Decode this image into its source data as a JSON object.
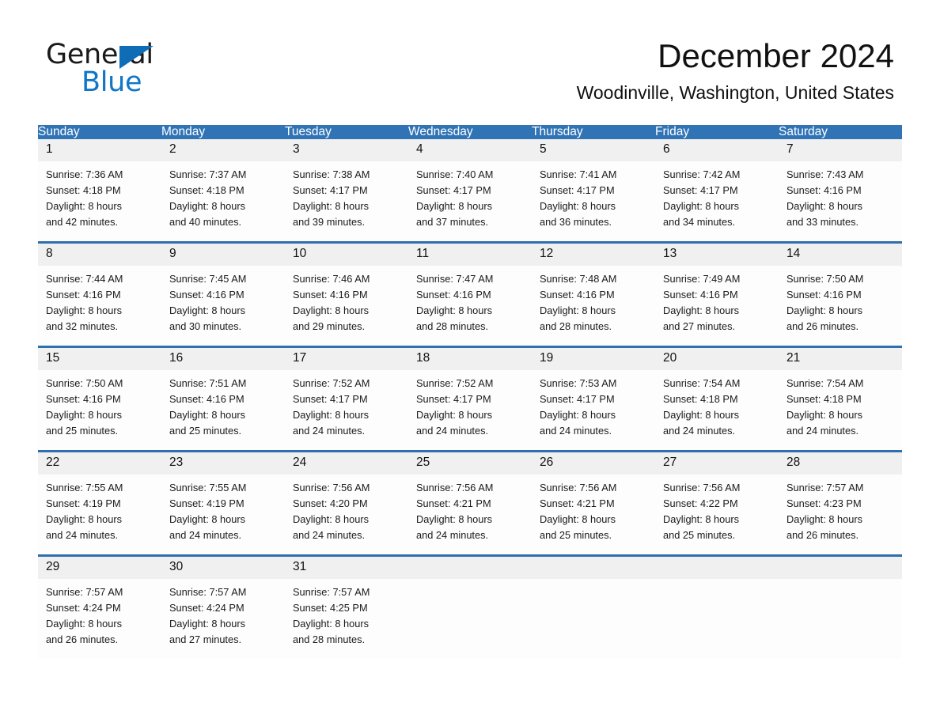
{
  "logo": {
    "word1": "General",
    "word2": "Blue",
    "triangle_color": "#0f6cb6",
    "blue_text_color": "#0f76c8"
  },
  "header": {
    "month_year": "December 2024",
    "location": "Woodinville, Washington, United States"
  },
  "theme": {
    "header_blue": "#3174b6",
    "separator_blue": "#2f6fae",
    "daynum_band": "#f0f0f0",
    "cell_background": "#fdfdfd"
  },
  "weekday_headers": [
    "Sunday",
    "Monday",
    "Tuesday",
    "Wednesday",
    "Thursday",
    "Friday",
    "Saturday"
  ],
  "weeks": [
    {
      "days": [
        {
          "num": "1",
          "sunrise": "Sunrise: 7:36 AM",
          "sunset": "Sunset: 4:18 PM",
          "daylight1": "Daylight: 8 hours",
          "daylight2": "and 42 minutes."
        },
        {
          "num": "2",
          "sunrise": "Sunrise: 7:37 AM",
          "sunset": "Sunset: 4:18 PM",
          "daylight1": "Daylight: 8 hours",
          "daylight2": "and 40 minutes."
        },
        {
          "num": "3",
          "sunrise": "Sunrise: 7:38 AM",
          "sunset": "Sunset: 4:17 PM",
          "daylight1": "Daylight: 8 hours",
          "daylight2": "and 39 minutes."
        },
        {
          "num": "4",
          "sunrise": "Sunrise: 7:40 AM",
          "sunset": "Sunset: 4:17 PM",
          "daylight1": "Daylight: 8 hours",
          "daylight2": "and 37 minutes."
        },
        {
          "num": "5",
          "sunrise": "Sunrise: 7:41 AM",
          "sunset": "Sunset: 4:17 PM",
          "daylight1": "Daylight: 8 hours",
          "daylight2": "and 36 minutes."
        },
        {
          "num": "6",
          "sunrise": "Sunrise: 7:42 AM",
          "sunset": "Sunset: 4:17 PM",
          "daylight1": "Daylight: 8 hours",
          "daylight2": "and 34 minutes."
        },
        {
          "num": "7",
          "sunrise": "Sunrise: 7:43 AM",
          "sunset": "Sunset: 4:16 PM",
          "daylight1": "Daylight: 8 hours",
          "daylight2": "and 33 minutes."
        }
      ]
    },
    {
      "days": [
        {
          "num": "8",
          "sunrise": "Sunrise: 7:44 AM",
          "sunset": "Sunset: 4:16 PM",
          "daylight1": "Daylight: 8 hours",
          "daylight2": "and 32 minutes."
        },
        {
          "num": "9",
          "sunrise": "Sunrise: 7:45 AM",
          "sunset": "Sunset: 4:16 PM",
          "daylight1": "Daylight: 8 hours",
          "daylight2": "and 30 minutes."
        },
        {
          "num": "10",
          "sunrise": "Sunrise: 7:46 AM",
          "sunset": "Sunset: 4:16 PM",
          "daylight1": "Daylight: 8 hours",
          "daylight2": "and 29 minutes."
        },
        {
          "num": "11",
          "sunrise": "Sunrise: 7:47 AM",
          "sunset": "Sunset: 4:16 PM",
          "daylight1": "Daylight: 8 hours",
          "daylight2": "and 28 minutes."
        },
        {
          "num": "12",
          "sunrise": "Sunrise: 7:48 AM",
          "sunset": "Sunset: 4:16 PM",
          "daylight1": "Daylight: 8 hours",
          "daylight2": "and 28 minutes."
        },
        {
          "num": "13",
          "sunrise": "Sunrise: 7:49 AM",
          "sunset": "Sunset: 4:16 PM",
          "daylight1": "Daylight: 8 hours",
          "daylight2": "and 27 minutes."
        },
        {
          "num": "14",
          "sunrise": "Sunrise: 7:50 AM",
          "sunset": "Sunset: 4:16 PM",
          "daylight1": "Daylight: 8 hours",
          "daylight2": "and 26 minutes."
        }
      ]
    },
    {
      "days": [
        {
          "num": "15",
          "sunrise": "Sunrise: 7:50 AM",
          "sunset": "Sunset: 4:16 PM",
          "daylight1": "Daylight: 8 hours",
          "daylight2": "and 25 minutes."
        },
        {
          "num": "16",
          "sunrise": "Sunrise: 7:51 AM",
          "sunset": "Sunset: 4:16 PM",
          "daylight1": "Daylight: 8 hours",
          "daylight2": "and 25 minutes."
        },
        {
          "num": "17",
          "sunrise": "Sunrise: 7:52 AM",
          "sunset": "Sunset: 4:17 PM",
          "daylight1": "Daylight: 8 hours",
          "daylight2": "and 24 minutes."
        },
        {
          "num": "18",
          "sunrise": "Sunrise: 7:52 AM",
          "sunset": "Sunset: 4:17 PM",
          "daylight1": "Daylight: 8 hours",
          "daylight2": "and 24 minutes."
        },
        {
          "num": "19",
          "sunrise": "Sunrise: 7:53 AM",
          "sunset": "Sunset: 4:17 PM",
          "daylight1": "Daylight: 8 hours",
          "daylight2": "and 24 minutes."
        },
        {
          "num": "20",
          "sunrise": "Sunrise: 7:54 AM",
          "sunset": "Sunset: 4:18 PM",
          "daylight1": "Daylight: 8 hours",
          "daylight2": "and 24 minutes."
        },
        {
          "num": "21",
          "sunrise": "Sunrise: 7:54 AM",
          "sunset": "Sunset: 4:18 PM",
          "daylight1": "Daylight: 8 hours",
          "daylight2": "and 24 minutes."
        }
      ]
    },
    {
      "days": [
        {
          "num": "22",
          "sunrise": "Sunrise: 7:55 AM",
          "sunset": "Sunset: 4:19 PM",
          "daylight1": "Daylight: 8 hours",
          "daylight2": "and 24 minutes."
        },
        {
          "num": "23",
          "sunrise": "Sunrise: 7:55 AM",
          "sunset": "Sunset: 4:19 PM",
          "daylight1": "Daylight: 8 hours",
          "daylight2": "and 24 minutes."
        },
        {
          "num": "24",
          "sunrise": "Sunrise: 7:56 AM",
          "sunset": "Sunset: 4:20 PM",
          "daylight1": "Daylight: 8 hours",
          "daylight2": "and 24 minutes."
        },
        {
          "num": "25",
          "sunrise": "Sunrise: 7:56 AM",
          "sunset": "Sunset: 4:21 PM",
          "daylight1": "Daylight: 8 hours",
          "daylight2": "and 24 minutes."
        },
        {
          "num": "26",
          "sunrise": "Sunrise: 7:56 AM",
          "sunset": "Sunset: 4:21 PM",
          "daylight1": "Daylight: 8 hours",
          "daylight2": "and 25 minutes."
        },
        {
          "num": "27",
          "sunrise": "Sunrise: 7:56 AM",
          "sunset": "Sunset: 4:22 PM",
          "daylight1": "Daylight: 8 hours",
          "daylight2": "and 25 minutes."
        },
        {
          "num": "28",
          "sunrise": "Sunrise: 7:57 AM",
          "sunset": "Sunset: 4:23 PM",
          "daylight1": "Daylight: 8 hours",
          "daylight2": "and 26 minutes."
        }
      ]
    },
    {
      "days": [
        {
          "num": "29",
          "sunrise": "Sunrise: 7:57 AM",
          "sunset": "Sunset: 4:24 PM",
          "daylight1": "Daylight: 8 hours",
          "daylight2": "and 26 minutes."
        },
        {
          "num": "30",
          "sunrise": "Sunrise: 7:57 AM",
          "sunset": "Sunset: 4:24 PM",
          "daylight1": "Daylight: 8 hours",
          "daylight2": "and 27 minutes."
        },
        {
          "num": "31",
          "sunrise": "Sunrise: 7:57 AM",
          "sunset": "Sunset: 4:25 PM",
          "daylight1": "Daylight: 8 hours",
          "daylight2": "and 28 minutes."
        },
        {
          "num": "",
          "sunrise": "",
          "sunset": "",
          "daylight1": "",
          "daylight2": ""
        },
        {
          "num": "",
          "sunrise": "",
          "sunset": "",
          "daylight1": "",
          "daylight2": ""
        },
        {
          "num": "",
          "sunrise": "",
          "sunset": "",
          "daylight1": "",
          "daylight2": ""
        },
        {
          "num": "",
          "sunrise": "",
          "sunset": "",
          "daylight1": "",
          "daylight2": ""
        }
      ]
    }
  ]
}
